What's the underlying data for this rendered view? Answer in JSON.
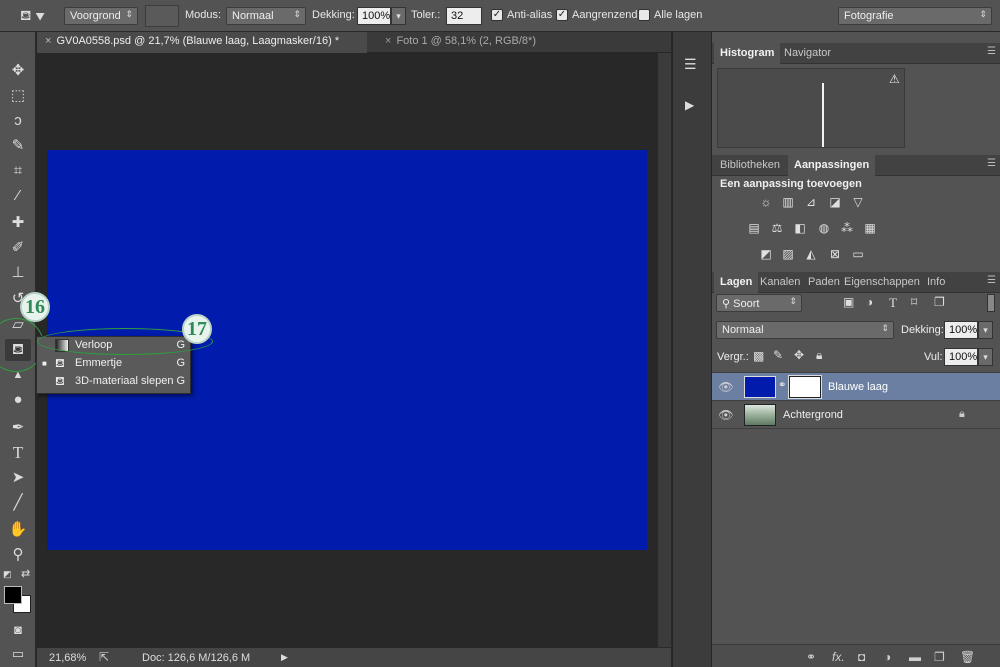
{
  "options_bar": {
    "fill_source": "Voorgrond",
    "mode_label": "Modus:",
    "mode_value": "Normaal",
    "opacity_label": "Dekking:",
    "opacity_value": "100%",
    "tolerance_label": "Toler.:",
    "tolerance_value": "32",
    "anti_alias_label": "Anti-alias",
    "anti_alias_checked": true,
    "contiguous_label": "Aangrenzend",
    "contiguous_checked": true,
    "all_layers_label": "Alle lagen",
    "all_layers_checked": false,
    "workspace": "Fotografie"
  },
  "tabs": [
    {
      "label": "GV0A0558.psd @ 21,7% (Blauwe laag, Laagmasker/16) *",
      "active": true
    },
    {
      "label": "Foto 1 @ 58,1% (2, RGB/8*)",
      "active": false
    }
  ],
  "canvas": {
    "fill_color": "#011bac"
  },
  "status": {
    "zoom": "21,68%",
    "doc": "Doc: 126,6 M/126,6 M"
  },
  "flyout": {
    "items": [
      {
        "label": "Verloop",
        "shortcut": "G",
        "icon": "gradient-icon",
        "selected": false
      },
      {
        "label": "Emmertje",
        "shortcut": "G",
        "icon": "paint-bucket-icon",
        "selected": true
      },
      {
        "label": "3D-materiaal slepen",
        "shortcut": "G",
        "icon": "3d-material-drop-icon",
        "selected": false
      }
    ]
  },
  "callouts": {
    "tool_step": "16",
    "menu_step": "17"
  },
  "panels": {
    "histogram_tabs": [
      "Histogram",
      "Navigator"
    ],
    "adjust_tabs": [
      "Bibliotheken",
      "Aanpassingen"
    ],
    "adjust_title": "Een aanpassing toevoegen",
    "layers_tabs": [
      "Lagen",
      "Kanalen",
      "Paden",
      "Eigenschappen",
      "Info"
    ],
    "filter_kind": "Soort",
    "blend_mode": "Normaal",
    "opacity_label": "Dekking:",
    "opacity_value": "100%",
    "lock_label": "Vergr.:",
    "fill_label": "Vul:",
    "fill_value": "100%",
    "layers": [
      {
        "name": "Blauwe laag",
        "selected": true,
        "thumb_color": "#011bac",
        "has_mask": true,
        "locked": false
      },
      {
        "name": "Achtergrond",
        "selected": false,
        "thumb_color": "#8aa48a",
        "has_mask": false,
        "locked": true
      }
    ]
  }
}
